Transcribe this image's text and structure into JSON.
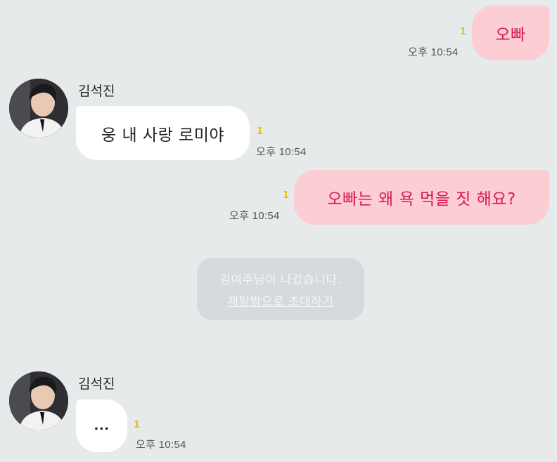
{
  "messages": {
    "m1": {
      "text": "오빠",
      "read": "1",
      "time": "오후 10:54"
    },
    "m2": {
      "sender": "김석진",
      "text": "웅 내 사랑 로미야",
      "read": "1",
      "time": "오후 10:54"
    },
    "m3": {
      "text": "오빠는 왜 욕 먹을 짓 해요?",
      "read": "1",
      "time": "오후 10:54"
    },
    "m4": {
      "sender": "김석진",
      "text": "...",
      "read": "1",
      "time": "오후 10:54"
    }
  },
  "system_notice": {
    "left_text": "김여주님이 나갔습니다.",
    "invite_link": "채팅방으로 초대하기"
  },
  "colors": {
    "background": "#e6eaeb",
    "my_bubble": "#fccdd3",
    "my_text": "#d8194d",
    "their_bubble": "#ffffff",
    "unread_count": "#e3c21c"
  },
  "icons": {
    "avatar": "profile-photo-avatar"
  }
}
